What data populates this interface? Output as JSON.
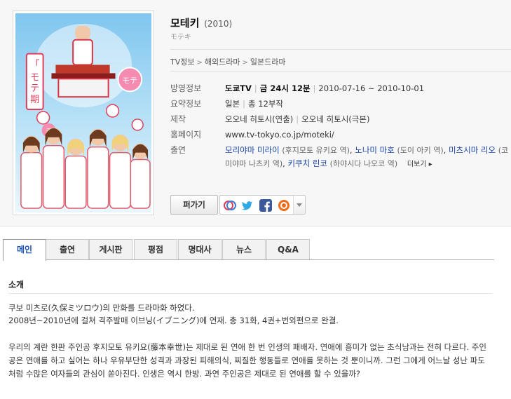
{
  "drama": {
    "title": "모테키",
    "year": "(2010)",
    "subtitle": "モテキ"
  },
  "breadcrumb": [
    "TV정보",
    "해외드라마",
    "일본드라마"
  ],
  "info": {
    "broadcast": {
      "label": "방영정보",
      "channel": "도쿄TV",
      "schedule": "금 24시 12분",
      "period": "2010-07-16 ~ 2010-10-01"
    },
    "summary": {
      "label": "요약정보",
      "country": "일본",
      "episodes": "총 12부작"
    },
    "production": {
      "label": "제작",
      "director": "오오네 히토시(연출)",
      "writer": "오오네 히토시(극본)"
    },
    "homepage": {
      "label": "홈페이지",
      "url": "www.tv-tokyo.co.jp/moteki/"
    },
    "cast": {
      "label": "출연",
      "members": [
        {
          "name": "모리야마 미라이",
          "role": "(후지모토 유키요 역)"
        },
        {
          "name": "노나미 마호",
          "role": "(도이 아키 역)"
        },
        {
          "name": "미츠시마 리오",
          "role": "(코미야마 나츠키 역)"
        },
        {
          "name": "키쿠치 린코",
          "role": "(하야시다 나오코 역)"
        }
      ],
      "more": "더보기"
    }
  },
  "actions": {
    "share_label": "퍼가기",
    "sns_icons": [
      "mypeople-icon",
      "twitter-icon",
      "facebook-icon",
      "daum-icon"
    ]
  },
  "tabs": [
    {
      "label": "메인",
      "active": true
    },
    {
      "label": "출연",
      "active": false
    },
    {
      "label": "게시판",
      "active": false
    },
    {
      "label": "평점",
      "active": false
    },
    {
      "label": "명대사",
      "active": false
    },
    {
      "label": "뉴스",
      "active": false
    },
    {
      "label": "Q&A",
      "active": false
    }
  ],
  "intro": {
    "title": "소개",
    "p1": "쿠보 미츠로(久保ミツロウ)의 만화를 드라마화 하였다.",
    "p2": "2008년~2010년에 걸쳐 격주발매 이브닝(イブニング)에 연재. 총 31화, 4권+번외편으로 완결.",
    "p3": "우리의 계란 한판 주인공 후지모토 유키요(藤本幸世)는 제대로 된 연애 한 번 인생의 패배자. 연애에 흥미가 없는 초식남과는 전혀 다르다. 주인공은 연애를 하고 싶어는 하나 우유부단한 성격과 과장된 피해의식, 찌질한 행동들로 연애를 못하는 것 뿐이니까. 그런 그에게 어느날 성난 파도처럼 수많은 여자들의 관심이 쏟아진다. 인생은 역시 한방. 과연 주인공은 제대로 된 연애를 할 수 있을까?"
  },
  "colors": {
    "link": "#1a44a8",
    "active_tab": "#1a4fb3",
    "twitter": "#2fa8e3",
    "facebook": "#3b5998",
    "daum": "#f26a1b"
  }
}
